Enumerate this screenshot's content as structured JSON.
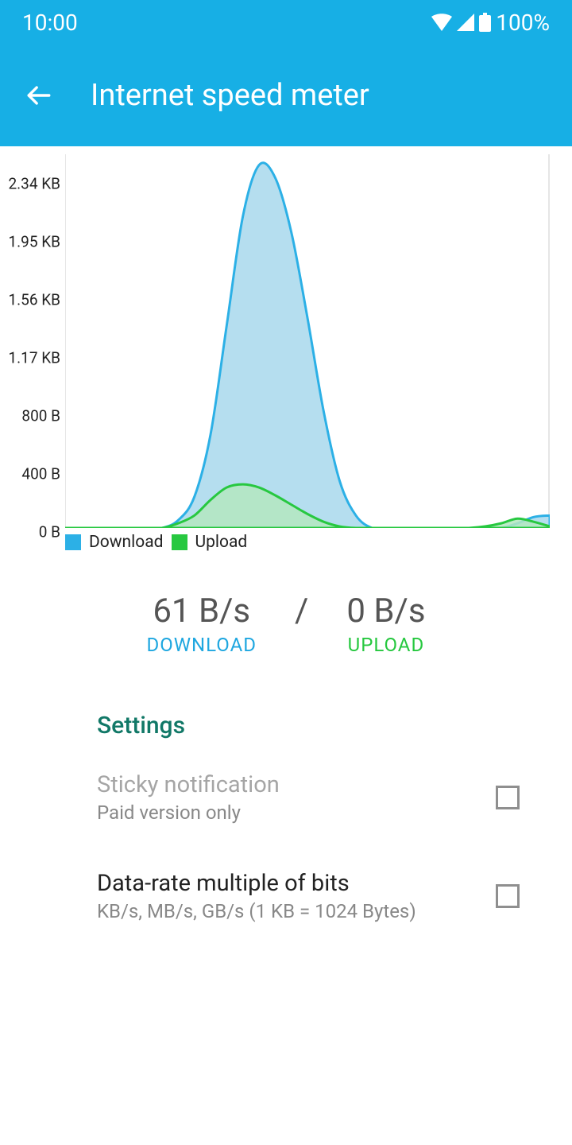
{
  "statusbar": {
    "time": "10:00",
    "battery": "100%"
  },
  "appbar": {
    "title": "Internet speed meter"
  },
  "chart_data": {
    "type": "area",
    "ylabel_ticks": [
      "2.34 KB",
      "1.95 KB",
      "1.56 KB",
      "1.17 KB",
      "800 B",
      "400 B",
      "0 B"
    ],
    "ylim_bytes": [
      0,
      2400
    ],
    "legend": {
      "download": "Download",
      "upload": "Upload"
    },
    "colors": {
      "download_stroke": "#2CB0E6",
      "download_fill": "#A8D8EC",
      "upload_stroke": "#27C840",
      "upload_fill": "#B4E8BF"
    },
    "series": [
      {
        "name": "Download",
        "values_bytes": [
          0,
          0,
          0,
          0,
          0,
          0,
          0,
          50,
          200,
          600,
          1300,
          2000,
          2330,
          2250,
          1900,
          1350,
          750,
          300,
          80,
          0,
          0,
          0,
          0,
          0,
          0,
          0,
          0,
          0,
          30,
          70,
          80
        ]
      },
      {
        "name": "Upload",
        "values_bytes": [
          0,
          0,
          0,
          0,
          0,
          0,
          0,
          30,
          80,
          180,
          260,
          280,
          260,
          210,
          150,
          90,
          40,
          10,
          0,
          0,
          0,
          0,
          0,
          0,
          0,
          0,
          10,
          30,
          60,
          40,
          10
        ]
      }
    ]
  },
  "readout": {
    "download_value": "61 B/s",
    "download_label": "DOWNLOAD",
    "separator": "/",
    "upload_value": "0 B/s",
    "upload_label": "UPLOAD"
  },
  "settings": {
    "header": "Settings",
    "items": [
      {
        "title": "Sticky notification",
        "subtitle": "Paid version only",
        "checked": false,
        "disabled": true
      },
      {
        "title": "Data-rate multiple of bits",
        "subtitle": "KB/s, MB/s, GB/s (1 KB = 1024 Bytes)",
        "checked": false,
        "disabled": false
      }
    ]
  }
}
